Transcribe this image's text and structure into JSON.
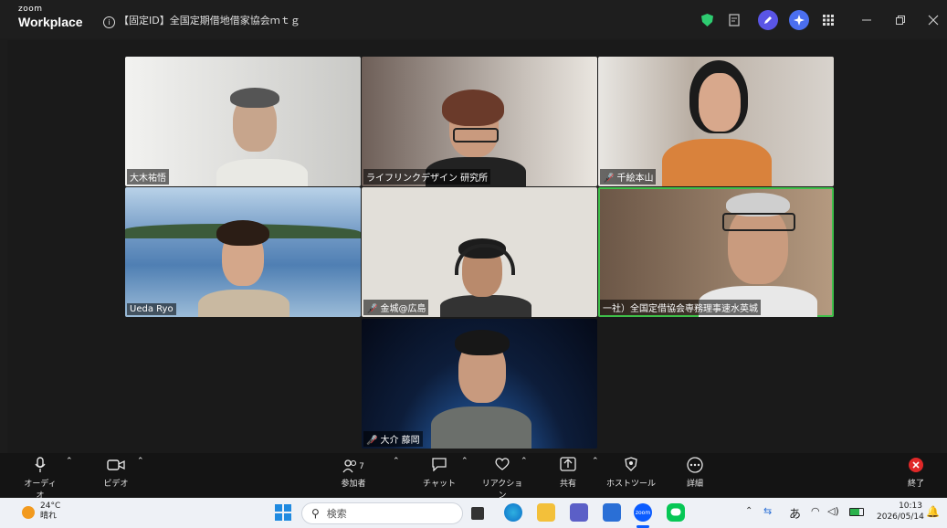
{
  "app": {
    "logo_small": "zoom",
    "logo_big": "Workplace"
  },
  "meeting": {
    "title": "【固定ID】全国定期借地借家協会ｍｔｇ",
    "info_icon": "info-icon"
  },
  "window_controls": [
    "shield-icon",
    "notes-icon",
    "edit-icon",
    "ai-companion-icon",
    "apps-icon",
    "minimize-icon",
    "restore-icon",
    "close-icon"
  ],
  "participants": [
    {
      "name": "大木祐悟",
      "muted": false,
      "bg": "#d9d9d6",
      "hair": "#555",
      "shirt": "#e9e9e4"
    },
    {
      "name": "ライフリンクデザイン 研究所",
      "muted": false,
      "bg": "#8a7a74",
      "hair": "#6a3a2a",
      "shirt": "#222"
    },
    {
      "name": "千絵本山",
      "muted": true,
      "bg": "#cfc9c1",
      "hair": "#1b1b1b",
      "shirt": "#d9823c"
    },
    {
      "name": "Ueda Ryo",
      "muted": false,
      "bg": "#5f89b5",
      "hair": "#2b1d15",
      "shirt": "#c9b9a1"
    },
    {
      "name": "金城@広島",
      "muted": true,
      "bg": "#dfdcd6",
      "hair": "#1c1c1c",
      "shirt": "#333"
    },
    {
      "name": "一社）全国定借協会専務理事速水英城",
      "muted": false,
      "bg": "#9b8068",
      "hair": "#cfcfcf",
      "shirt": "#e8e8e8",
      "active": true
    },
    {
      "name": "大介 藤岡",
      "muted": true,
      "bg": "#0d1d3a",
      "hair": "#171717",
      "shirt": "#6b6f6b"
    }
  ],
  "toolbar": {
    "audio": "オーディオ",
    "video": "ビデオ",
    "participants": "参加者",
    "participants_count": "7",
    "chat": "チャット",
    "reactions": "リアクション",
    "share": "共有",
    "host_tools": "ホストツール",
    "more": "詳細",
    "end": "終了"
  },
  "taskbar": {
    "weather_temp": "24°C",
    "weather_text": "晴れ",
    "search_placeholder": "検索",
    "ime": "あ",
    "time": "10:13",
    "date": "2026/05/14"
  }
}
